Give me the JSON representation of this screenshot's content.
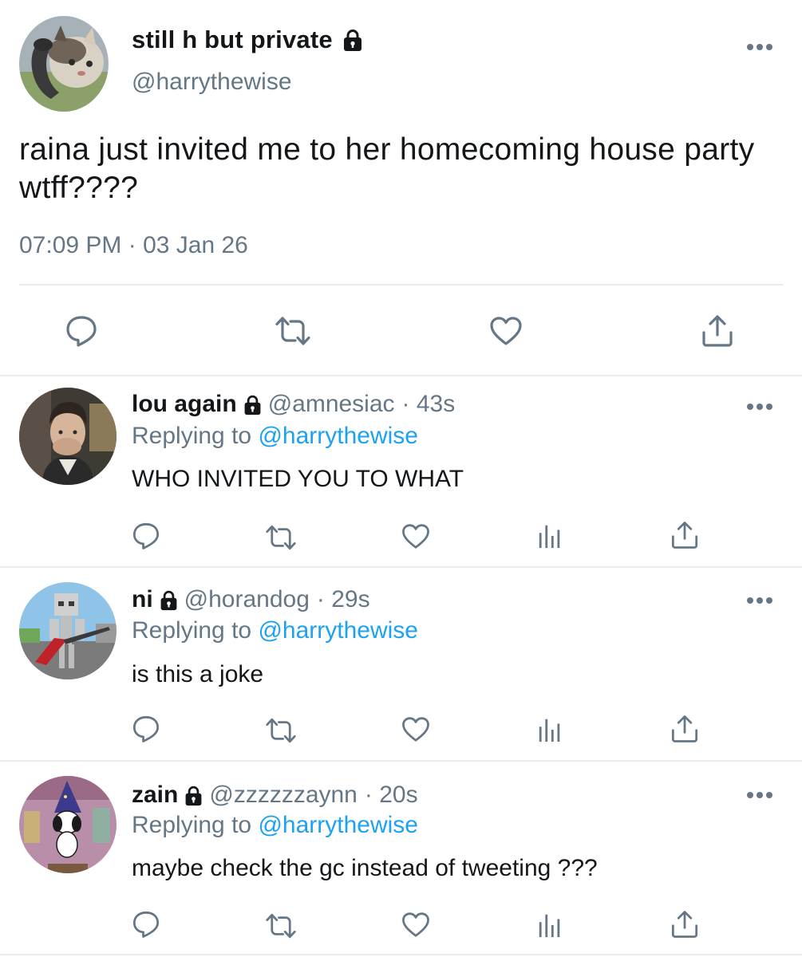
{
  "main_tweet": {
    "display_name": "still h but private",
    "handle": "@harrythewise",
    "text": "raina just invited me to her homecoming house party wtff????",
    "timestamp": "07:09 PM · 03 Jan 26",
    "avatar": "cat-on-phone-avatar"
  },
  "replies": [
    {
      "display_name": "lou again",
      "handle": "@amnesiac",
      "time": "· 43s",
      "replying_prefix": "Replying to",
      "replying_to": "@harrythewise",
      "text": "WHO INVITED YOU TO WHAT",
      "avatar": "man-covering-mouth-avatar"
    },
    {
      "display_name": "ni",
      "handle": "@horandog",
      "time": "· 29s",
      "replying_prefix": "Replying to",
      "replying_to": "@harrythewise",
      "text": "is this a joke",
      "avatar": "skeleton-guitar-avatar"
    },
    {
      "display_name": "zain",
      "handle": "@zzzzzzaynn",
      "time": "· 20s",
      "replying_prefix": "Replying to",
      "replying_to": "@harrythewise",
      "text": "maybe check the gc instead of tweeting ???",
      "avatar": "snoopy-wizard-avatar"
    }
  ],
  "colors": {
    "text": "#14171a",
    "secondary": "#657786",
    "link": "#1da1f2",
    "divider": "#e6ecf0",
    "icon": "#657786"
  }
}
